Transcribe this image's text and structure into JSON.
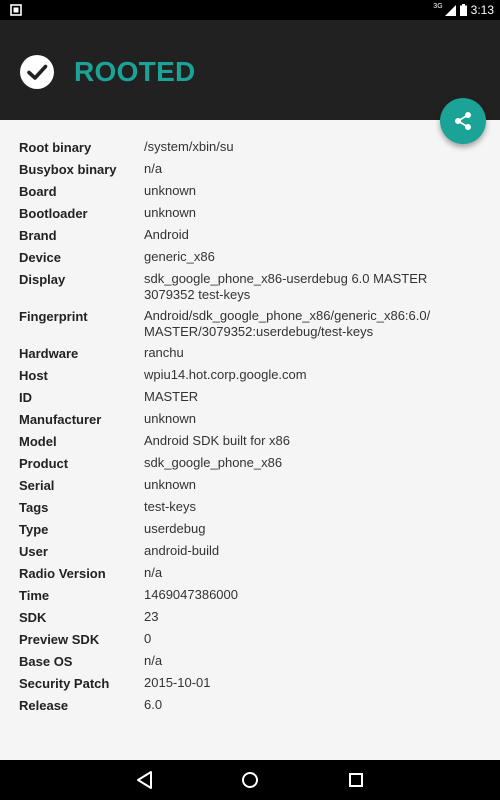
{
  "status_bar": {
    "network": "3G",
    "time": "3:13"
  },
  "app_bar": {
    "title": "ROOTED",
    "status_icon": "check-circle-icon",
    "accent_color": "#1aa396",
    "background_color": "#212121"
  },
  "fab": {
    "icon": "share-icon"
  },
  "info": [
    {
      "label": "Root binary",
      "value": "/system/xbin/su"
    },
    {
      "label": "Busybox binary",
      "value": "n/a"
    },
    {
      "label": "Board",
      "value": "unknown"
    },
    {
      "label": "Bootloader",
      "value": "unknown"
    },
    {
      "label": "Brand",
      "value": "Android"
    },
    {
      "label": "Device",
      "value": "generic_x86"
    },
    {
      "label": "Display",
      "value": "sdk_google_phone_x86-userdebug 6.0 MASTER 3079352 test-keys"
    },
    {
      "label": "Fingerprint",
      "value": "Android/sdk_google_phone_x86/generic_x86:6.0/ MASTER/3079352:userdebug/test-keys"
    },
    {
      "label": "Hardware",
      "value": "ranchu"
    },
    {
      "label": "Host",
      "value": "wpiu14.hot.corp.google.com"
    },
    {
      "label": "ID",
      "value": "MASTER"
    },
    {
      "label": "Manufacturer",
      "value": "unknown"
    },
    {
      "label": "Model",
      "value": "Android SDK built for x86"
    },
    {
      "label": "Product",
      "value": "sdk_google_phone_x86"
    },
    {
      "label": "Serial",
      "value": "unknown"
    },
    {
      "label": "Tags",
      "value": "test-keys"
    },
    {
      "label": "Type",
      "value": "userdebug"
    },
    {
      "label": "User",
      "value": "android-build"
    },
    {
      "label": "Radio Version",
      "value": "n/a"
    },
    {
      "label": "Time",
      "value": "1469047386000"
    },
    {
      "label": "SDK",
      "value": "23"
    },
    {
      "label": "Preview SDK",
      "value": "0"
    },
    {
      "label": "Base OS",
      "value": "n/a"
    },
    {
      "label": "Security Patch",
      "value": "2015-10-01"
    },
    {
      "label": "Release",
      "value": "6.0"
    }
  ],
  "nav_bar": {
    "back": "back-icon",
    "home": "home-icon",
    "recents": "recents-icon"
  }
}
